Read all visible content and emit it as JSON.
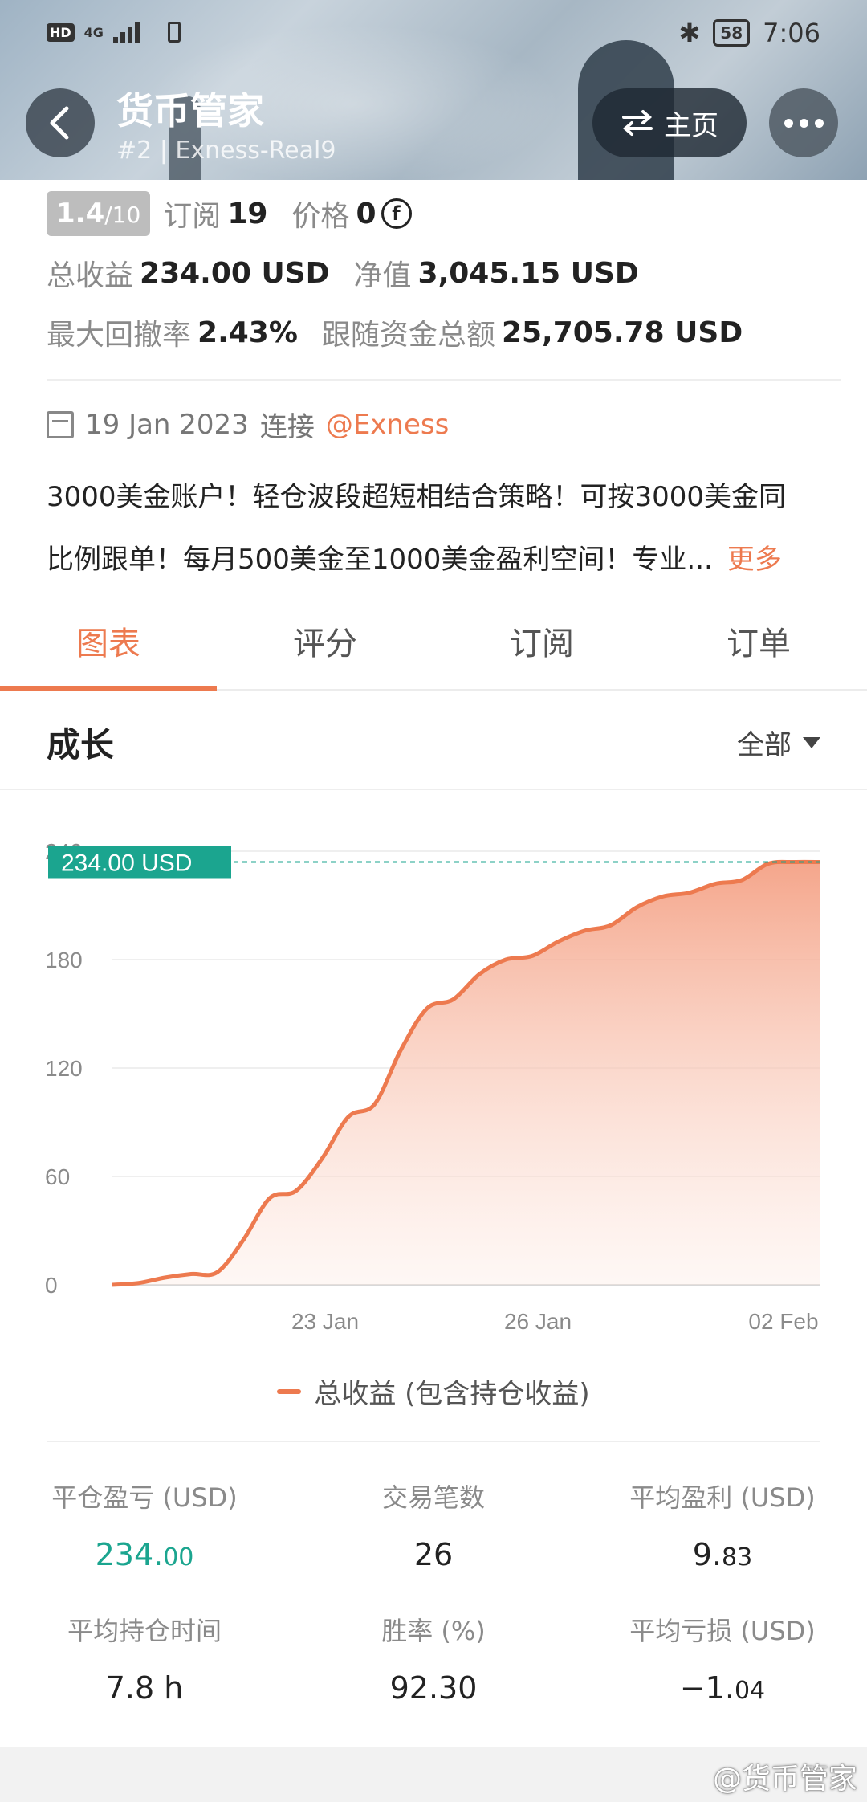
{
  "status_bar": {
    "network": "HD",
    "signal": "4G",
    "battery": "58",
    "time": "7:06"
  },
  "header": {
    "title": "货币管家",
    "subtitle": "#2 | Exness-Real9",
    "home_label": "主页"
  },
  "info": {
    "rating_main": "1.4",
    "rating_denom": "/10",
    "subscribe_label": "订阅",
    "subscribe_value": "19",
    "price_label": "价格",
    "price_value": "0",
    "coin_symbol": "f",
    "total_profit_label": "总收益",
    "total_profit_value": "234.00 USD",
    "net_value_label": "净值",
    "net_value_value": "3,045.15 USD",
    "max_drawdown_label": "最大回撤率",
    "max_drawdown_value": "2.43%",
    "follow_funds_label": "跟随资金总额",
    "follow_funds_value": "25,705.78 USD",
    "date": "19 Jan 2023",
    "connect_label": "连接",
    "broker": "@Exness",
    "description_line1": "3000美金账户！轻仓波段超短相结合策略！可按3000美金同",
    "description_line2": "比例跟单！每月500美金至1000美金盈利空间！专业...",
    "more": "更多"
  },
  "tabs": [
    "图表",
    "评分",
    "订阅",
    "订单"
  ],
  "section": {
    "title": "成长",
    "filter": "全部"
  },
  "chart_data": {
    "type": "area",
    "x_ticks": [
      "23 Jan",
      "26 Jan",
      "02 Feb"
    ],
    "y_ticks": [
      "0",
      "60",
      "120",
      "180",
      "240"
    ],
    "ylim": [
      0,
      240
    ],
    "current_label": "234.00 USD",
    "current_value": 234,
    "series": [
      {
        "name": "总收益 (包含持仓收益)",
        "color": "#ed7a4f",
        "values": [
          0,
          1,
          4,
          6,
          7,
          25,
          48,
          52,
          70,
          93,
          100,
          130,
          153,
          158,
          172,
          180,
          182,
          190,
          196,
          199,
          209,
          215,
          217,
          222,
          224,
          233,
          234,
          234
        ]
      }
    ]
  },
  "legend": "总收益 (包含持仓收益)",
  "stats": {
    "closed_pnl_label": "平仓盈亏 (USD)",
    "closed_pnl_main": "234.",
    "closed_pnl_dec": "00",
    "trades_label": "交易笔数",
    "trades_value": "26",
    "avg_profit_label": "平均盈利 (USD)",
    "avg_profit_main": "9.",
    "avg_profit_dec": "83",
    "avg_hold_label": "平均持仓时间",
    "avg_hold_value": "7.8 h",
    "win_rate_label": "胜率 (%)",
    "win_rate_value": "92.30",
    "avg_loss_label": "平均亏损 (USD)",
    "avg_loss_main": "−1.",
    "avg_loss_dec": "04"
  },
  "watermark": "@货币管家"
}
